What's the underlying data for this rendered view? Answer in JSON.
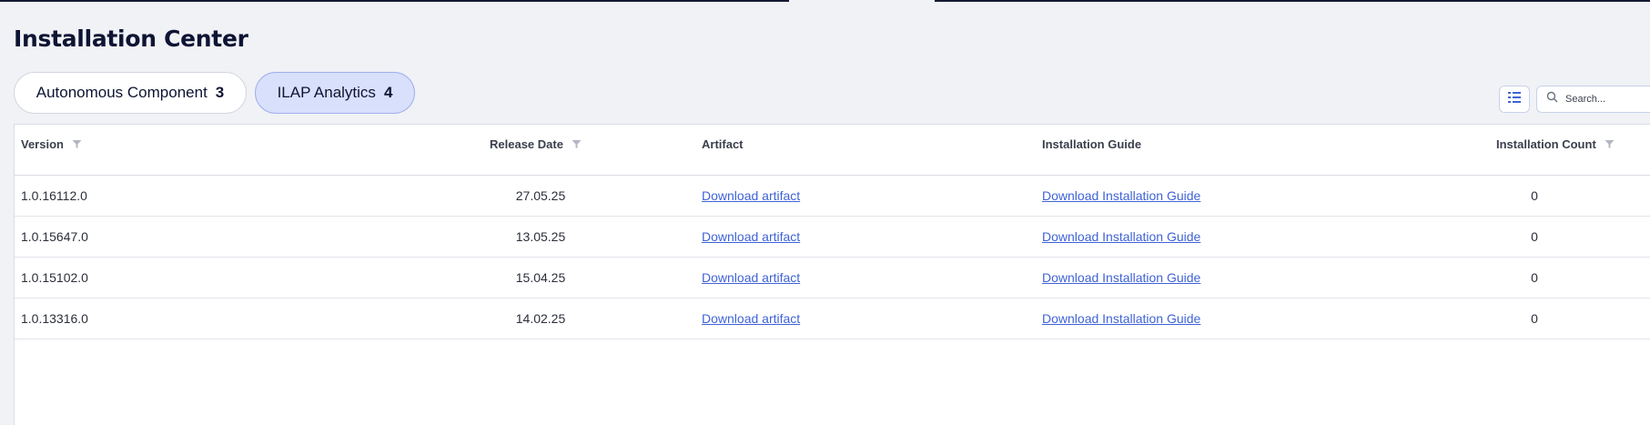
{
  "page": {
    "title": "Installation Center"
  },
  "tabs": [
    {
      "label": "Autonomous Component",
      "count": "3",
      "active": false
    },
    {
      "label": "ILAP Analytics",
      "count": "4",
      "active": true
    }
  ],
  "toolbar": {
    "view_toggle_icon": "column-list-icon",
    "search_placeholder": "Search..."
  },
  "table": {
    "columns": {
      "version": "Version",
      "release_date": "Release Date",
      "artifact": "Artifact",
      "installation_guide": "Installation Guide",
      "installation_count": "Installation Count"
    },
    "rows": [
      {
        "version": "1.0.16112.0",
        "release_date": "27.05.25",
        "artifact": "Download artifact",
        "guide": "Download Installation Guide",
        "count": "0"
      },
      {
        "version": "1.0.15647.0",
        "release_date": "13.05.25",
        "artifact": "Download artifact",
        "guide": "Download Installation Guide",
        "count": "0"
      },
      {
        "version": "1.0.15102.0",
        "release_date": "15.04.25",
        "artifact": "Download artifact",
        "guide": "Download Installation Guide",
        "count": "0"
      },
      {
        "version": "1.0.13316.0",
        "release_date": "14.02.25",
        "artifact": "Download artifact",
        "guide": "Download Installation Guide",
        "count": "0"
      }
    ]
  },
  "colors": {
    "accent": "#3f63d6",
    "active_tab_bg": "#d9e0fb",
    "title": "#0e1433"
  }
}
